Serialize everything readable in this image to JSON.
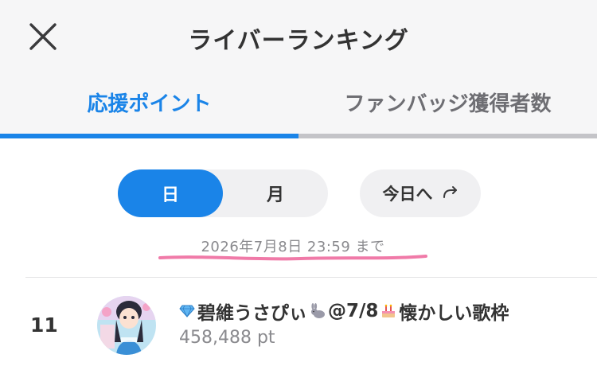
{
  "header": {
    "title": "ライバーランキング",
    "close_icon": "close-icon"
  },
  "tabs": [
    {
      "label": "応援ポイント",
      "active": true
    },
    {
      "label": "ファンバッジ獲得者数",
      "active": false
    }
  ],
  "period_toggle": {
    "options": [
      {
        "label": "日",
        "selected": true
      },
      {
        "label": "月",
        "selected": false
      }
    ]
  },
  "today_button": {
    "label": "今日へ",
    "icon": "redo-arrow-icon"
  },
  "deadline_text": "2026年7月8日 23:59 まで",
  "ranking": [
    {
      "rank": "11",
      "name_part1": "碧維うさぴぃ",
      "name_part2": "@7/8",
      "name_part3": "懐かしい歌枠",
      "points": "458,488 pt"
    }
  ],
  "colors": {
    "accent": "#1a84e8",
    "header_bg": "#f6f6f7",
    "highlight_underline": "#f07aa8"
  }
}
